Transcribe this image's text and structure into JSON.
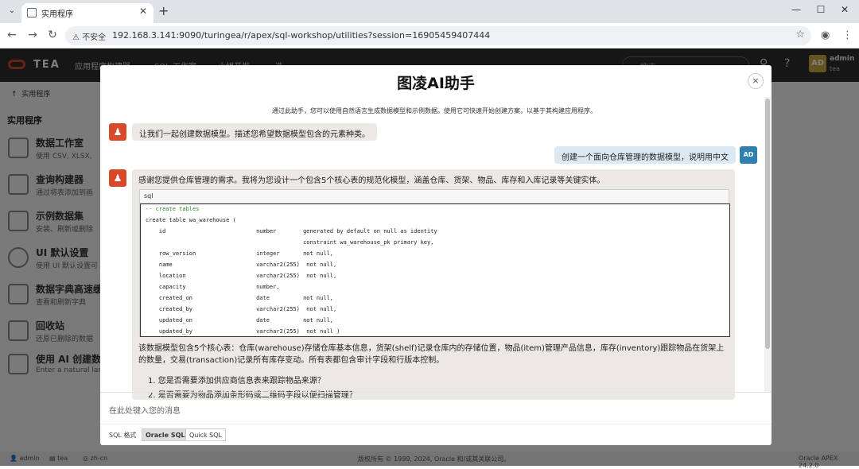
{
  "browser": {
    "tab_title": "实用程序",
    "new_tab": "+",
    "window_controls": {
      "minimize": "—",
      "maximize": "☐",
      "close": "✕"
    },
    "security_label": "不安全",
    "url": "192.168.3.141:9090/turingea/r/apex/sql-workshop/utilities?session=16905459407444"
  },
  "apex": {
    "logo_text": "TEA",
    "nav": [
      "应用程序构建器",
      "SQL 工作室",
      "小组开发",
      "迭"
    ],
    "search_placeholder": "搜索",
    "user": {
      "initials": "AD",
      "name": "admin",
      "workspace": "tea"
    },
    "breadcrumb": "实用程序",
    "sidebar_title": "实用程序",
    "sidebar_items": [
      {
        "title": "数据工作室",
        "desc": "使用 CSV, XLSX,",
        "icon": "wrench-icon"
      },
      {
        "title": "查询构建器",
        "desc": "通过将表添加到画",
        "icon": "query-icon"
      },
      {
        "title": "示例数据集",
        "desc": "安装、刷新或删除",
        "icon": "folder-icon"
      },
      {
        "title": "UI 默认设置",
        "desc": "使用 UI 默认设置可",
        "icon": "defaults-icon"
      },
      {
        "title": "数据字典高速缓",
        "desc": "查看和刷新字典",
        "icon": "database-icon"
      },
      {
        "title": "回收站",
        "desc": "还原已删除的数据",
        "icon": "recycle-icon"
      },
      {
        "title": "使用 AI 创建数据",
        "desc": "Enter a natural lan",
        "icon": "ai-icon"
      }
    ],
    "footer": {
      "user": "admin",
      "workspace": "tea",
      "lang": "zh-cn",
      "copyright": "版权所有 © 1999, 2024, Oracle 和/或其关联公司。",
      "version": "Oracle APEX 24.2.0"
    }
  },
  "dialog": {
    "title": "图凌AI助手",
    "close": "×",
    "intro": "通过此助手，您可以使用自然语言生成数据模型和示例数据。使用它可快速开始创建方案，以基于其构建应用程序。",
    "bot_greeting": "让我们一起创建数据模型。描述您希望数据模型包含的元素种类。",
    "user_message": "创建一个面向仓库管理的数据模型，说明用中文",
    "user_initials": "AD",
    "bot_reply_intro": "感谢您提供仓库管理的需求。我将为您设计一个包含5个核心表的规范化模型，涵盖仓库、货架、物品、库存和入库记录等关键实体。",
    "code_label": "sql",
    "code_lines": [
      "-- create tables",
      "create table wa_warehouse (",
      "    id                           number        generated by default on null as identity",
      "                                               constraint wa_warehouse_pk primary key,",
      "    row_version                  integer       not null,",
      "    name                         varchar2(255)  not null,",
      "    location                     varchar2(255)  not null,",
      "    capacity                     number,",
      "    created_on                   date          not null,",
      "    created_by                   varchar2(255)  not null,",
      "    updated_on                   date          not null,",
      "    updated_by                   varchar2(255)  not null )"
    ],
    "bot_reply_summary": "该数据模型包含5个核心表：仓库(warehouse)存储仓库基本信息，货架(shelf)记录仓库内的存储位置，物品(item)管理产品信息，库存(inventory)跟踪物品在货架上的数量，交易(transaction)记录所有库存变动。所有表都包含审计字段和行版本控制。",
    "questions": [
      "1. 您是否需要添加供应商信息表来跟踪物品来源？",
      "2. 是否需要为物品添加条形码或二维码字段以便扫描管理？"
    ],
    "input_placeholder": "在此处键入您的消息",
    "format_label": "SQL 格式",
    "format_options": [
      "Oracle SQL",
      "Quick SQL"
    ]
  }
}
